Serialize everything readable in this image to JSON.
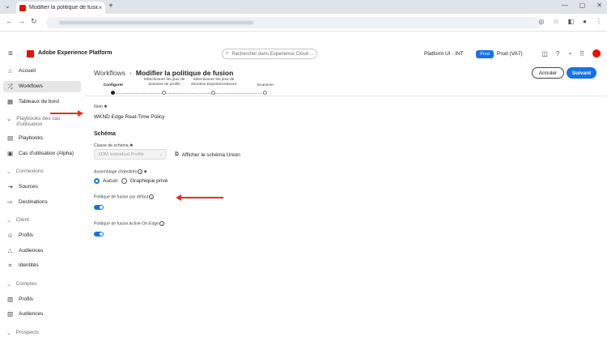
{
  "browser": {
    "tab_title": "Modifier la politique de fusion",
    "tab_close": "×",
    "new_tab": "+",
    "tab_menu": "⌄"
  },
  "app": {
    "name": "Adobe Experience Platform",
    "search_placeholder": "Rechercher dans Experience Cloud ...",
    "org": "Platform UI - INT",
    "sandbox_badge": "Prod",
    "sandbox_name": "Prod (VA7)"
  },
  "sidebar": {
    "items": [
      {
        "label": "Accueil",
        "icon": "home-icon",
        "glyph": "⌂"
      },
      {
        "label": "Workflows",
        "icon": "workflows-icon",
        "glyph": "⤮"
      },
      {
        "label": "Tableaux de bord",
        "icon": "dashboard-icon",
        "glyph": "▦"
      },
      {
        "label": "Playbooks des cas d'utilisation",
        "icon": "chevron-down-icon",
        "glyph": "⌄"
      },
      {
        "label": "Playbooks",
        "icon": "playbooks-icon",
        "glyph": "▤"
      },
      {
        "label": "Cas d'utilisation (Alpha)",
        "icon": "usecase-icon",
        "glyph": "▣"
      },
      {
        "label": "Connexions",
        "icon": "chevron-down-icon",
        "glyph": "⌄"
      },
      {
        "label": "Sources",
        "icon": "sources-icon",
        "glyph": "⇥"
      },
      {
        "label": "Destinations",
        "icon": "destinations-icon",
        "glyph": "⇨"
      },
      {
        "label": "Client",
        "icon": "chevron-down-icon",
        "glyph": "⌄"
      },
      {
        "label": "Profils",
        "icon": "profiles-icon",
        "glyph": "☺"
      },
      {
        "label": "Audiences",
        "icon": "audiences-icon",
        "glyph": "⛬"
      },
      {
        "label": "Identités",
        "icon": "identities-icon",
        "glyph": "⌗"
      },
      {
        "label": "Comptes",
        "icon": "chevron-down-icon",
        "glyph": "⌄"
      },
      {
        "label": "Profils",
        "icon": "account-profiles-icon",
        "glyph": "▥"
      },
      {
        "label": "Audiences",
        "icon": "account-audiences-icon",
        "glyph": "▥"
      },
      {
        "label": "Prospects",
        "icon": "chevron-down-icon",
        "glyph": "⌄"
      }
    ]
  },
  "page": {
    "breadcrumb_parent": "Workflows",
    "breadcrumb_sep": "›",
    "breadcrumb_current": "Modifier la politique de fusion",
    "cancel_label": "Annuler",
    "next_label": "Suivant",
    "steps": [
      {
        "label": "Configurer"
      },
      {
        "label": "Sélectionner les jeux de données de profils"
      },
      {
        "label": "Sélectionner les jeux de données ExperienceEvent"
      },
      {
        "label": "Examiner"
      }
    ]
  },
  "form": {
    "name_label": "Nom",
    "name_value": "WKND Edge Real-Time Policy",
    "schema_title": "Schéma",
    "schema_class_label": "Classe de schéma",
    "schema_class_value": "XDM Individual Profile",
    "union_link": "Afficher le schéma Union",
    "id_stitching_label": "Assemblage d'identités",
    "radio_none": "Aucun",
    "radio_private_graph": "Graphique privé",
    "default_policy_label": "Politique de fusion par défaut",
    "active_edge_label": "Politique de fusion Active-On-Edge"
  },
  "colors": {
    "accent": "#1473e6",
    "brand": "#eb1000",
    "annotation_arrow": "#e0311f"
  }
}
